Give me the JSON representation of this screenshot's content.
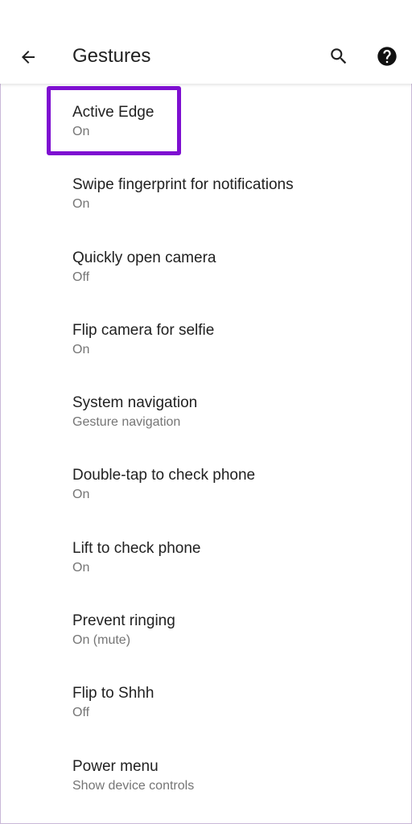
{
  "header": {
    "title": "Gestures",
    "back_icon": "arrow-back-icon",
    "search_icon": "search-icon",
    "help_icon": "help-icon"
  },
  "colors": {
    "highlight": "#7e0fd1",
    "title_text": "#212121",
    "summary_text": "#757575"
  },
  "settings": [
    {
      "title": "Active Edge",
      "summary": "On"
    },
    {
      "title": "Swipe fingerprint for notifications",
      "summary": "On"
    },
    {
      "title": "Quickly open camera",
      "summary": "Off"
    },
    {
      "title": "Flip camera for selfie",
      "summary": "On"
    },
    {
      "title": "System navigation",
      "summary": "Gesture navigation"
    },
    {
      "title": "Double-tap to check phone",
      "summary": "On"
    },
    {
      "title": "Lift to check phone",
      "summary": "On"
    },
    {
      "title": "Prevent ringing",
      "summary": "On (mute)"
    },
    {
      "title": "Flip to Shhh",
      "summary": "Off"
    },
    {
      "title": "Power menu",
      "summary": "Show device controls"
    }
  ]
}
